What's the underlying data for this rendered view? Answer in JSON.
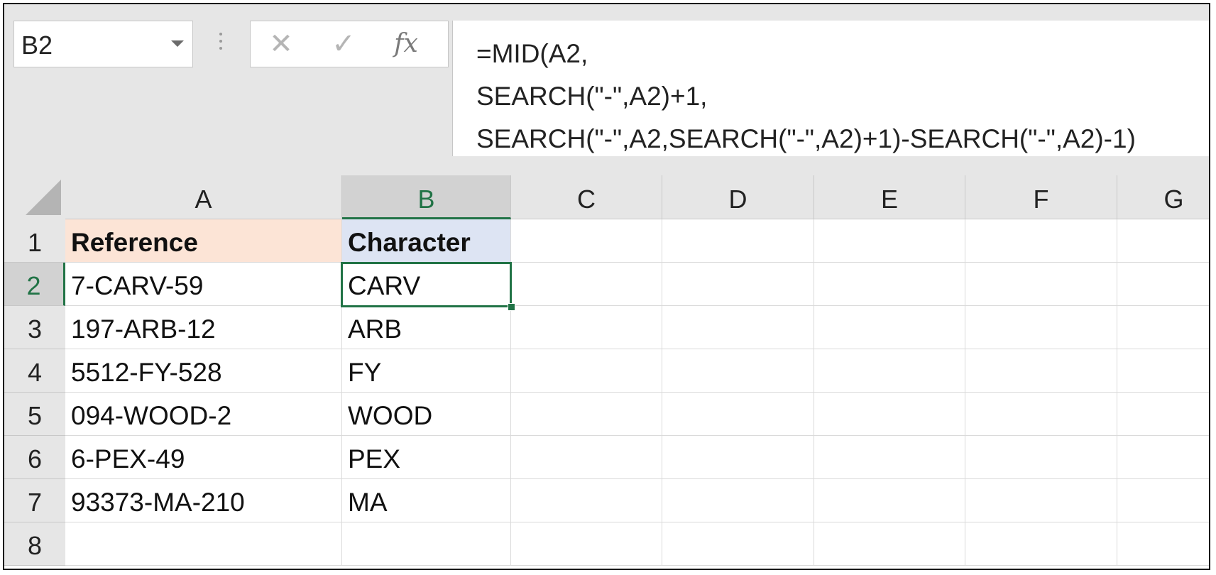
{
  "name_box": {
    "value": "B2"
  },
  "formula_bar": {
    "cancel_icon": "✕",
    "enter_icon": "✓",
    "fx_label": "fx",
    "formula_lines": [
      "=MID(A2,",
      "SEARCH(\"-\",A2)+1,",
      "SEARCH(\"-\",A2,SEARCH(\"-\",A2)+1)-SEARCH(\"-\",A2)-1)"
    ]
  },
  "grid": {
    "columns": [
      "A",
      "B",
      "C",
      "D",
      "E",
      "F",
      "G"
    ],
    "rows": [
      "1",
      "2",
      "3",
      "4",
      "5",
      "6",
      "7",
      "8"
    ],
    "active_cell": "B2",
    "cells": [
      [
        "Reference",
        "Character",
        "",
        "",
        "",
        "",
        ""
      ],
      [
        "7-CARV-59",
        "CARV",
        "",
        "",
        "",
        "",
        ""
      ],
      [
        "197-ARB-12",
        "ARB",
        "",
        "",
        "",
        "",
        ""
      ],
      [
        "5512-FY-528",
        "FY",
        "",
        "",
        "",
        "",
        ""
      ],
      [
        "094-WOOD-2",
        "WOOD",
        "",
        "",
        "",
        "",
        ""
      ],
      [
        "6-PEX-49",
        "PEX",
        "",
        "",
        "",
        "",
        ""
      ],
      [
        "93373-MA-210",
        "MA",
        "",
        "",
        "",
        "",
        ""
      ],
      [
        "",
        "",
        "",
        "",
        "",
        "",
        ""
      ]
    ],
    "header_fill_colors": {
      "A1": "#fce4d6",
      "B1": "#dde4f3"
    },
    "accent_color": "#217346"
  }
}
